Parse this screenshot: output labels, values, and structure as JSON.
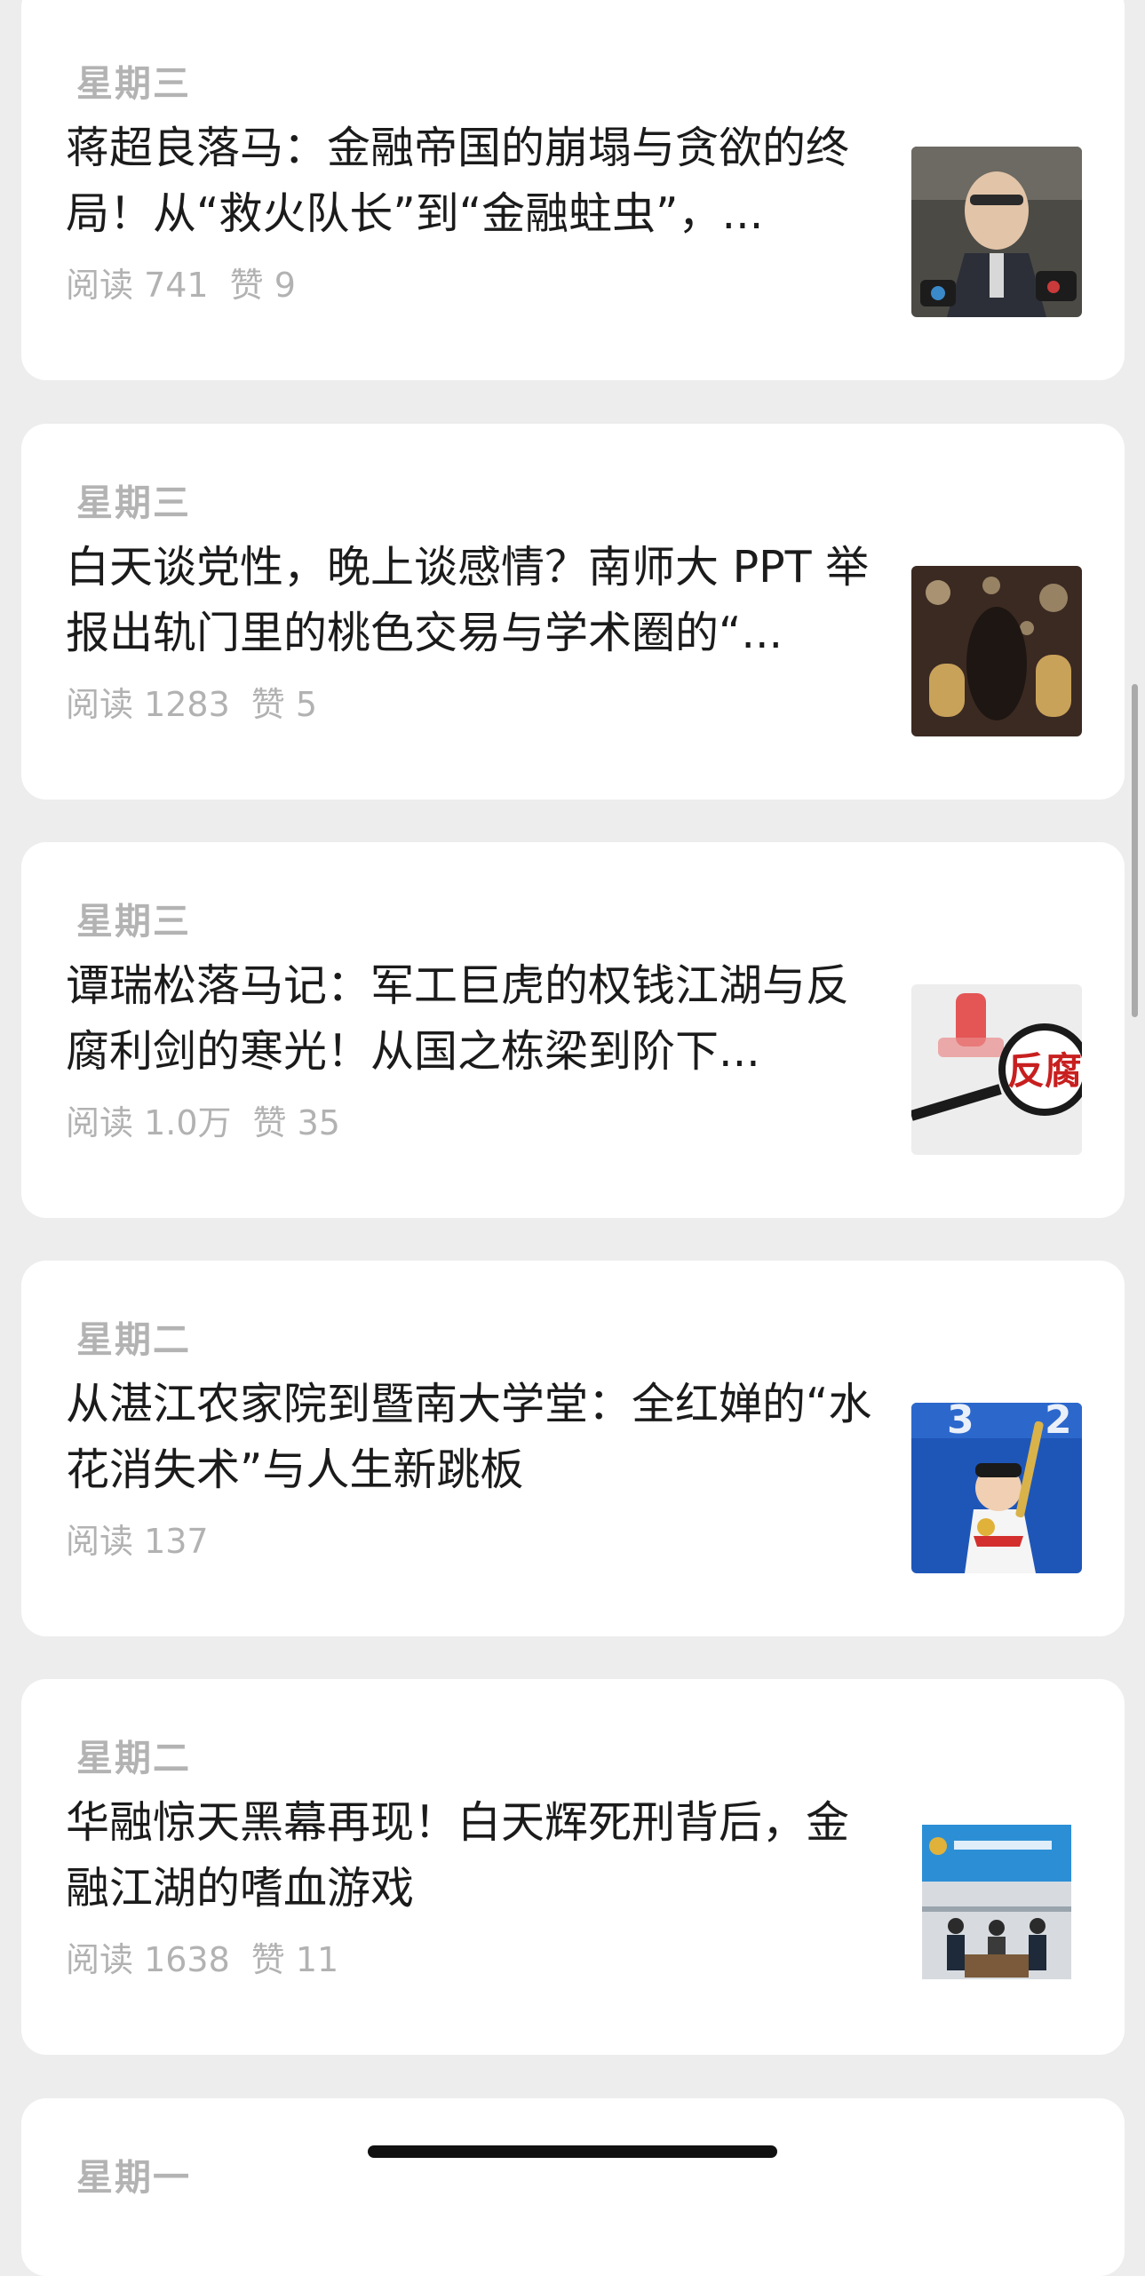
{
  "articles": [
    {
      "day": "星期三",
      "title": "蒋超良落马：金融帝国的崩塌与贪欲的终局！从“救火队长”到“金融蛀虫”，...",
      "reads_label": "阅读 741",
      "likes_label": "赞 9",
      "thumbnail": "press-interview-photo"
    },
    {
      "day": "星期三",
      "title": "白天谈党性，晚上谈感情？南师大 PPT 举报出轨门里的桃色交易与学术圈的“...",
      "reads_label": "阅读 1283",
      "likes_label": "赞 5",
      "thumbnail": "love-balloons-photo"
    },
    {
      "day": "星期三",
      "title": "谭瑞松落马记：军工巨虎的权钱江湖与反腐利剑的寒光！从国之栋梁到阶下...",
      "reads_label": "阅读 1.0万",
      "likes_label": "赞 35",
      "thumbnail": "anti-corruption-magnifier",
      "thumbnail_text": "反腐"
    },
    {
      "day": "星期二",
      "title": "从湛江农家院到暨南大学堂：全红婵的“水花消失术”与人生新跳板",
      "reads_label": "阅读 137",
      "likes_label": "",
      "thumbnail": "athlete-torch-photo"
    },
    {
      "day": "星期二",
      "title": "华融惊天黑幕再现！白天辉死刑背后，金融江湖的嗜血游戏",
      "reads_label": "阅读 1638",
      "likes_label": "赞 11",
      "thumbnail": "courtroom-photo"
    },
    {
      "day": "星期一",
      "title": "",
      "reads_label": "",
      "likes_label": "",
      "thumbnail": ""
    }
  ]
}
